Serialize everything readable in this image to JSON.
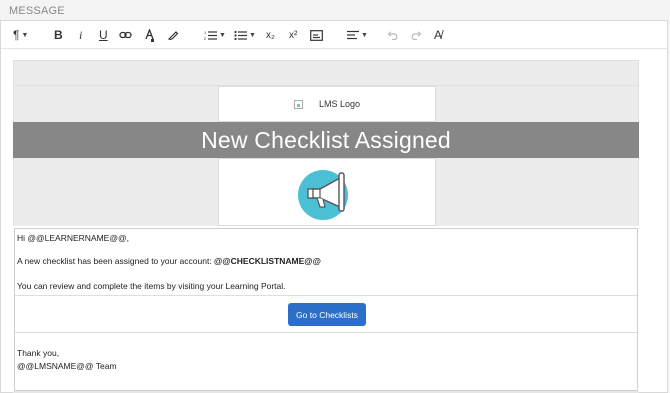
{
  "section_label": "MESSAGE",
  "toolbar": {
    "paragraph": "¶",
    "bold": "B",
    "italic": "i",
    "underline": "U",
    "subscript": "x₂",
    "superscript": "x²",
    "clear_format": "A̸"
  },
  "email": {
    "logo_alt": "LMS Logo",
    "banner_title": "New Checklist Assigned",
    "greeting": "Hi @@LEARNERNAME@@,",
    "assigned_text": "A new checklist has been assigned to your account: ",
    "checklist_token": "@@CHECKLISTNAME@@",
    "review_text": "You can review and complete the items by visiting your Learning Portal.",
    "button_label": "Go to Checklists",
    "thanks": "Thank you,",
    "signature": "@@LMSNAME@@ Team"
  },
  "colors": {
    "banner": "#878787",
    "button": "#2b6fc9",
    "megaphone_circle": "#4bbfd3"
  }
}
